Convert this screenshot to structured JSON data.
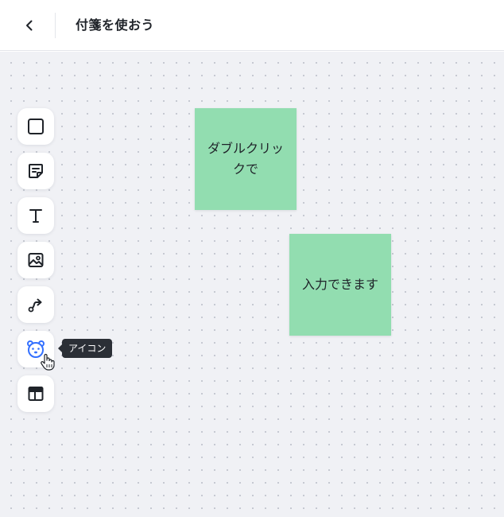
{
  "header": {
    "title": "付箋を使おう"
  },
  "toolbar": {
    "tools": [
      {
        "name": "square",
        "icon": "square-icon"
      },
      {
        "name": "sticky-note",
        "icon": "sticky-note-icon"
      },
      {
        "name": "text",
        "icon": "text-icon"
      },
      {
        "name": "image",
        "icon": "image-icon"
      },
      {
        "name": "connector",
        "icon": "connector-arrow-icon"
      },
      {
        "name": "icon",
        "icon": "bear-icon",
        "active": true
      },
      {
        "name": "layout",
        "icon": "layout-template-icon"
      }
    ],
    "tooltip": "アイコン"
  },
  "stickies": [
    {
      "text": "ダブルクリックで",
      "color": "#92ddb0"
    },
    {
      "text": "入力できます",
      "color": "#92ddb0"
    }
  ],
  "colors": {
    "canvas_bg": "#f0f1f5",
    "sticky": "#92ddb0",
    "active_icon": "#3370ff",
    "tooltip_bg": "#2b2f36"
  }
}
